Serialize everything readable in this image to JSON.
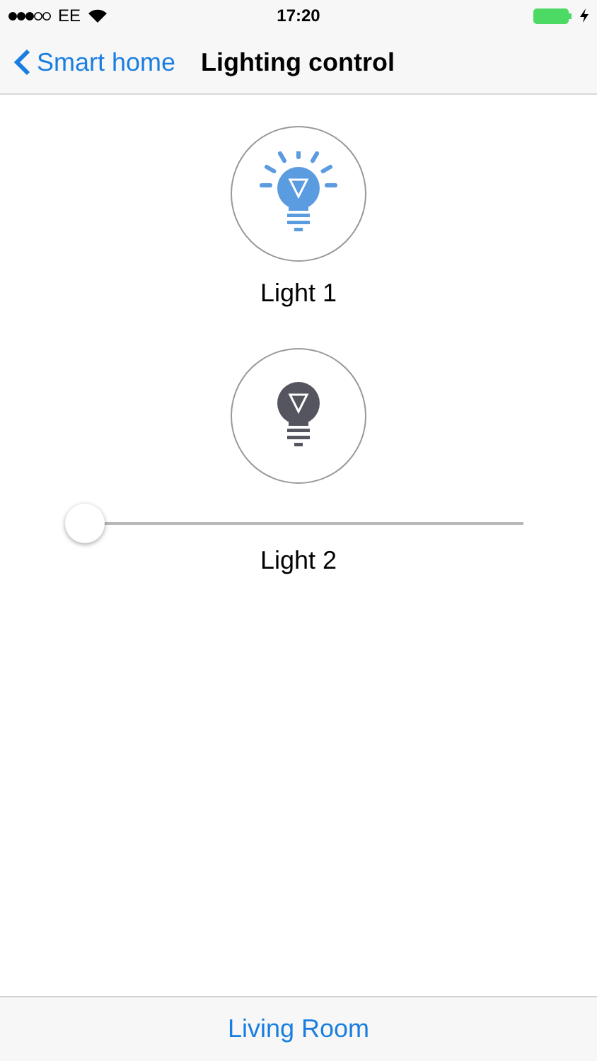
{
  "status_bar": {
    "carrier": "EE",
    "time": "17:20",
    "charging": true
  },
  "nav": {
    "back": "Smart home",
    "title": "Lighting control"
  },
  "lights": [
    {
      "kind": "switch",
      "name": "Light 1",
      "on": true
    },
    {
      "kind": "dimmer",
      "name": "Light 2",
      "on": false,
      "level": 0
    }
  ],
  "footer": {
    "room": "Living Room"
  }
}
